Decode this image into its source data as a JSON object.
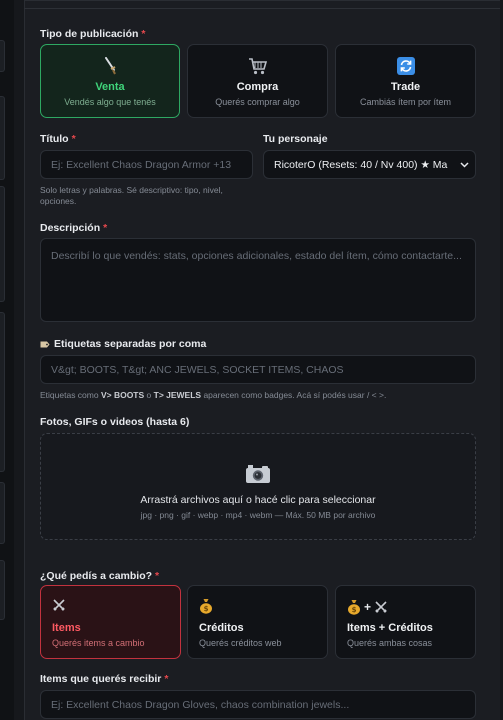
{
  "tipo": {
    "label": "Tipo de publicación",
    "required_mark": "*",
    "options": [
      {
        "icon": "sword-icon",
        "title": "Venta",
        "sub": "Vendés algo que tenés",
        "state": "selected"
      },
      {
        "icon": "shopping-cart-icon",
        "title": "Compra",
        "sub": "Querés comprar algo",
        "state": "normal"
      },
      {
        "icon": "refresh-icon",
        "title": "Trade",
        "sub": "Cambiás ítem por ítem",
        "state": "normal"
      }
    ]
  },
  "titulo": {
    "label": "Título",
    "required_mark": "*",
    "placeholder": "Ej: Excellent Chaos Dragon Armor +13",
    "hint": "Solo letras y palabras. Sé descriptivo: tipo, nivel, opciones."
  },
  "personaje": {
    "label": "Tu personaje",
    "selected": "RicoterO (Resets: 40 / Nv 400) ★ Ma"
  },
  "descripcion": {
    "label": "Descripción",
    "required_mark": "*",
    "placeholder": "Describí lo que vendés: stats, opciones adicionales, estado del ítem, cómo contactarte..."
  },
  "etiquetas": {
    "icon": "tag-icon",
    "label": "Etiquetas separadas por coma",
    "placeholder": "V&gt; BOOTS, T&gt; ANC JEWELS, SOCKET ITEMS, CHAOS",
    "hint_prefix": "Etiquetas como ",
    "hint_b1": "V> BOOTS",
    "hint_mid": " o ",
    "hint_b2": "T> JEWELS",
    "hint_suffix": " aparecen como badges. Acá sí podés usar / < >."
  },
  "fotos": {
    "label": "Fotos, GIFs o videos (hasta 6)",
    "drop_text": "Arrastrá archivos aquí o hacé clic para seleccionar",
    "formats": "jpg · png · gif · webp · mp4 · webm — Máx. 50 MB por archivo"
  },
  "cambio": {
    "label": "¿Qué pedís a cambio?",
    "required_mark": "*",
    "options": [
      {
        "icon": "crossed-swords-icon",
        "title": "Items",
        "sub": "Querés items a cambio",
        "state": "selected"
      },
      {
        "icon": "money-bag-icon",
        "title": "Créditos",
        "sub": "Querés créditos web",
        "state": "normal"
      },
      {
        "icon": "money-bag-and-swords-icon",
        "title": "Items + Créditos",
        "sub": "Querés ambas cosas",
        "state": "normal"
      }
    ],
    "combo_sep": "+"
  },
  "items_recibir": {
    "label": "Items que querés recibir",
    "required_mark": "*",
    "placeholder": "Ej: Excellent Chaos Dragon Gloves, chaos combination jewels..."
  },
  "colors": {
    "accent_green": "#2ea862",
    "accent_red": "#c2323e",
    "required": "#e5484d"
  }
}
